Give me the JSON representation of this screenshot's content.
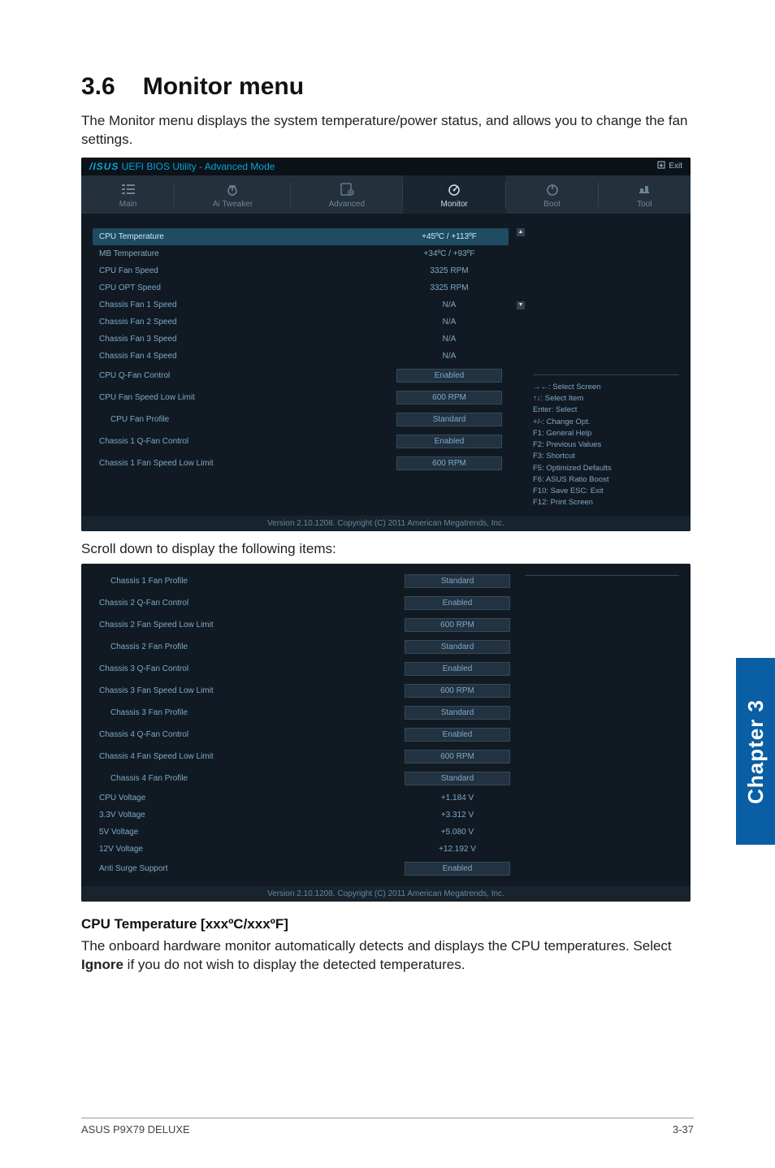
{
  "section": {
    "number": "3.6",
    "title": "Monitor menu"
  },
  "intro_text": "The Monitor menu displays the system temperature/power status, and allows you to change the fan settings.",
  "bios": {
    "title_prefix": "/ISUS",
    "title_rest": " UEFI BIOS Utility - Advanced Mode",
    "exit_label": "Exit",
    "tabs": [
      {
        "label": "Main"
      },
      {
        "label": "Ai Tweaker"
      },
      {
        "label": "Advanced"
      },
      {
        "label": "Monitor"
      },
      {
        "label": "Boot"
      },
      {
        "label": "Tool"
      }
    ],
    "rows1": [
      {
        "label": "CPU Temperature",
        "value": "+45ºC / +113ºF",
        "boxed": false,
        "hilite": true
      },
      {
        "label": "MB Temperature",
        "value": "+34ºC / +93ºF",
        "boxed": false
      },
      {
        "label": "CPU Fan Speed",
        "value": "3325 RPM",
        "boxed": false
      },
      {
        "label": "CPU OPT Speed",
        "value": "3325 RPM",
        "boxed": false
      },
      {
        "label": "Chassis Fan 1 Speed",
        "value": "N/A",
        "boxed": false
      },
      {
        "label": "Chassis Fan 2 Speed",
        "value": "N/A",
        "boxed": false
      },
      {
        "label": "Chassis Fan 3 Speed",
        "value": "N/A",
        "boxed": false
      },
      {
        "label": "Chassis Fan 4 Speed",
        "value": "N/A",
        "boxed": false
      },
      {
        "label": "CPU Q-Fan Control",
        "value": "Enabled",
        "boxed": true
      },
      {
        "label": "CPU Fan Speed Low Limit",
        "value": "600 RPM",
        "boxed": true
      },
      {
        "label": "CPU Fan Profile",
        "value": "Standard",
        "boxed": true,
        "indent": true
      },
      {
        "label": "Chassis 1 Q-Fan Control",
        "value": "Enabled",
        "boxed": true
      },
      {
        "label": "Chassis 1 Fan Speed Low Limit",
        "value": "600 RPM",
        "boxed": true
      }
    ],
    "help_lines": [
      "→←: Select Screen",
      "↑↓: Select Item",
      "Enter: Select",
      "+/-: Change Opt.",
      "F1: General Help",
      "F2: Previous Values",
      "F3: Shortcut",
      "F5: Optimized Defaults",
      "F6: ASUS Ratio Boost",
      "F10: Save   ESC: Exit",
      "F12: Print Screen"
    ],
    "footer": "Version 2.10.1208.  Copyright (C) 2011 American Megatrends, Inc."
  },
  "scroll_text": "Scroll down to display the following items:",
  "bios2": {
    "rows": [
      {
        "label": "Chassis 1 Fan Profile",
        "value": "Standard",
        "boxed": true,
        "indent": true
      },
      {
        "label": "Chassis 2 Q-Fan Control",
        "value": "Enabled",
        "boxed": true
      },
      {
        "label": "Chassis 2 Fan Speed Low Limit",
        "value": "600 RPM",
        "boxed": true
      },
      {
        "label": "Chassis 2 Fan Profile",
        "value": "Standard",
        "boxed": true,
        "indent": true
      },
      {
        "label": "Chassis 3 Q-Fan Control",
        "value": "Enabled",
        "boxed": true
      },
      {
        "label": "Chassis 3 Fan Speed Low Limit",
        "value": "600 RPM",
        "boxed": true
      },
      {
        "label": "Chassis 3 Fan Profile",
        "value": "Standard",
        "boxed": true,
        "indent": true
      },
      {
        "label": "Chassis 4 Q-Fan Control",
        "value": "Enabled",
        "boxed": true
      },
      {
        "label": "Chassis 4 Fan Speed Low Limit",
        "value": "600 RPM",
        "boxed": true
      },
      {
        "label": "Chassis 4 Fan Profile",
        "value": "Standard",
        "boxed": true,
        "indent": true
      },
      {
        "label": "CPU Voltage",
        "value": "+1.184 V",
        "boxed": false
      },
      {
        "label": "3.3V Voltage",
        "value": "+3.312 V",
        "boxed": false
      },
      {
        "label": "5V Voltage",
        "value": "+5.080 V",
        "boxed": false
      },
      {
        "label": "12V Voltage",
        "value": "+12.192 V",
        "boxed": false
      },
      {
        "label": "Anti Surge Support",
        "value": "Enabled",
        "boxed": true
      }
    ]
  },
  "cpu_temp_section": {
    "heading": "CPU Temperature [xxxºC/xxxºF]",
    "body_a": "The onboard hardware monitor automatically detects and displays the CPU temperatures. Select ",
    "body_bold": "Ignore",
    "body_b": " if you do not wish to display the detected temperatures."
  },
  "side_tab": "Chapter 3",
  "footer": {
    "left": "ASUS P9X79 DELUXE",
    "right": "3-37"
  }
}
